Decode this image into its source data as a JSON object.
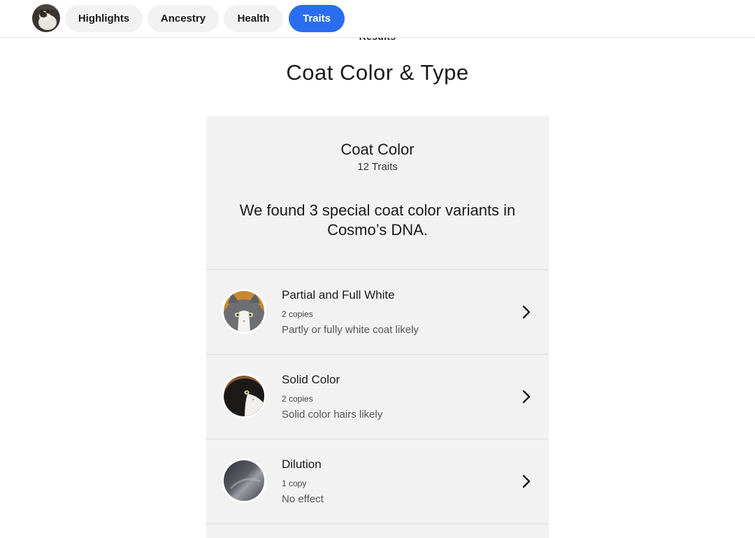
{
  "nav": {
    "avatar_icon": "cat-photo-avatar",
    "tabs": [
      {
        "label": "Highlights",
        "active": false
      },
      {
        "label": "Ancestry",
        "active": false
      },
      {
        "label": "Health",
        "active": false
      },
      {
        "label": "Traits",
        "active": true
      }
    ],
    "accent_color": "#2a6df0"
  },
  "section_label": "Results",
  "page_title": "Coat Color & Type",
  "card": {
    "title": "Coat Color",
    "count": "12 Traits",
    "summary": "We found 3 special coat color variants in Cosmo’s DNA.",
    "items": [
      {
        "name": "Partial and Full White",
        "copies": "2 copies",
        "effect": "Partly or fully white coat likely",
        "icon": "cat-face-thumbnail"
      },
      {
        "name": "Solid Color",
        "copies": "2 copies",
        "effect": "Solid color hairs likely",
        "icon": "cat-face-thumbnail"
      },
      {
        "name": "Dilution",
        "copies": "1 copy",
        "effect": "No effect",
        "icon": "cat-fur-thumbnail"
      }
    ]
  }
}
